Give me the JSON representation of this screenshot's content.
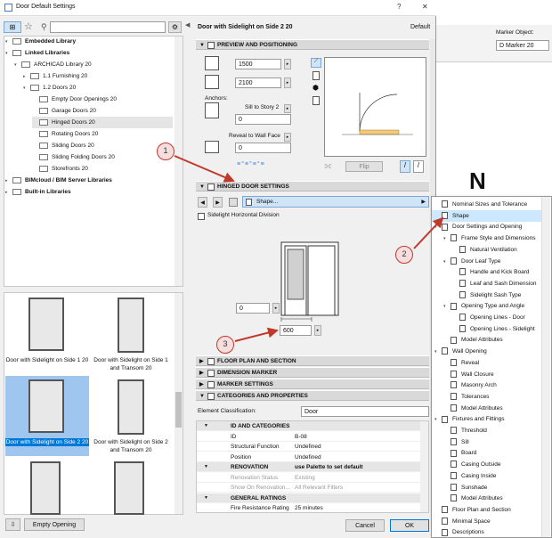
{
  "window": {
    "title": "Door Default Settings",
    "help": "?",
    "close": "✕"
  },
  "header": {
    "name": "Door with Sidelight on Side 2 20",
    "default_label": "Default"
  },
  "bg_app": {
    "marker_label": "Marker Object:",
    "marker_value": "D Marker 20",
    "north_letter": "N"
  },
  "library_tree": [
    {
      "label": "Embedded Library",
      "level": 0
    },
    {
      "label": "Linked Libraries",
      "level": 0
    },
    {
      "label": "ARCHICAD Library 20",
      "level": 1
    },
    {
      "label": "1.1 Furnishing 20",
      "level": 2
    },
    {
      "label": "1.2 Doors 20",
      "level": 2
    },
    {
      "label": "Empty Door Openings 20",
      "level": 3
    },
    {
      "label": "Garage Doors 20",
      "level": 3
    },
    {
      "label": "Hinged Doors 20",
      "level": 3,
      "selected": true
    },
    {
      "label": "Rotating Doors 20",
      "level": 3
    },
    {
      "label": "Sliding Doors 20",
      "level": 3
    },
    {
      "label": "Sliding Folding Doors 20",
      "level": 3
    },
    {
      "label": "Storefronts 20",
      "level": 3
    },
    {
      "label": "BIMcloud / BIM Server Libraries",
      "level": 0
    },
    {
      "label": "Built-in Libraries",
      "level": 0
    }
  ],
  "thumbnails": [
    {
      "label": "Door with Sidelight on Side 1 20"
    },
    {
      "label": "Door with Sidelight on Side 1 and Transom 20"
    },
    {
      "label": "Door with Sidelight on Side 2 20",
      "selected": true
    },
    {
      "label": "Door with Sidelight on Side 2 and Transom 20"
    }
  ],
  "footer": {
    "empty_opening": "Empty Opening",
    "cancel": "Cancel",
    "ok": "OK"
  },
  "preview": {
    "title": "PREVIEW AND POSITIONING",
    "width": "1500",
    "height": "2100",
    "anchors_label": "Anchors:",
    "sill_label": "Sill to Story 2",
    "sill_value": "0",
    "reveal_label": "Reveal to Wall Face",
    "reveal_value": "0",
    "flip_label": "Flip"
  },
  "hinged": {
    "title": "HINGED DOOR SETTINGS",
    "page_selector": "Shape...",
    "sidelight_checkbox": "Sidelight Horizontal Division",
    "bottom_value": "0",
    "sidelight_width": "600"
  },
  "sections": {
    "floor_plan": "FLOOR PLAN AND SECTION",
    "dimension": "DIMENSION MARKER",
    "marker": "MARKER SETTINGS",
    "categories": "CATEGORIES AND PROPERTIES"
  },
  "classification": {
    "label": "Element Classification:",
    "value": "Door"
  },
  "properties": [
    {
      "name": "ID AND CATEGORIES",
      "value": "",
      "type": "group"
    },
    {
      "name": "ID",
      "value": "B-08",
      "type": "row"
    },
    {
      "name": "Structural Function",
      "value": "Undefined",
      "type": "row"
    },
    {
      "name": "Position",
      "value": "Undefined",
      "type": "row"
    },
    {
      "name": "RENOVATION",
      "value": "use Palette to set default",
      "type": "group"
    },
    {
      "name": "Renovation Status",
      "value": "Existing",
      "type": "dim"
    },
    {
      "name": "Show On Renovation...",
      "value": "All Relevant Filters",
      "type": "dim"
    },
    {
      "name": "GENERAL RATINGS",
      "value": "",
      "type": "group"
    },
    {
      "name": "Fire Resistance Rating",
      "value": "25 minutes",
      "type": "row"
    }
  ],
  "menu": [
    {
      "label": "Nominal Sizes and Tolerance",
      "level": 0
    },
    {
      "label": "Shape",
      "level": 0,
      "selected": true
    },
    {
      "label": "Door Settings and Opening",
      "level": 0
    },
    {
      "label": "Frame Style and Dimensions",
      "level": 1
    },
    {
      "label": "Natural Ventilation",
      "level": 2
    },
    {
      "label": "Door Leaf Type",
      "level": 1
    },
    {
      "label": "Handle and Kick Board",
      "level": 2
    },
    {
      "label": "Leaf and Sash Dimension",
      "level": 2
    },
    {
      "label": "Sidelight Sash Type",
      "level": 2
    },
    {
      "label": "Opening Type and Angle",
      "level": 1
    },
    {
      "label": "Opening Lines - Door",
      "level": 2
    },
    {
      "label": "Opening Lines - Sidelight",
      "level": 2
    },
    {
      "label": "Model Attributes",
      "level": 1
    },
    {
      "label": "Wall Opening",
      "level": 0
    },
    {
      "label": "Reveal",
      "level": 1
    },
    {
      "label": "Wall Closure",
      "level": 1
    },
    {
      "label": "Masonry Arch",
      "level": 1
    },
    {
      "label": "Tolerances",
      "level": 1
    },
    {
      "label": "Model Attributes",
      "level": 1
    },
    {
      "label": "Fixtures and Fittings",
      "level": 0
    },
    {
      "label": "Threshold",
      "level": 1
    },
    {
      "label": "Sill",
      "level": 1
    },
    {
      "label": "Board",
      "level": 1
    },
    {
      "label": "Casing Outside",
      "level": 1
    },
    {
      "label": "Casing Inside",
      "level": 1
    },
    {
      "label": "Sunshade",
      "level": 1
    },
    {
      "label": "Model Attributes",
      "level": 1
    },
    {
      "label": "Floor Plan and Section",
      "level": 0
    },
    {
      "label": "Minimal Space",
      "level": 0
    },
    {
      "label": "Descriptions",
      "level": 0
    }
  ],
  "callouts": [
    {
      "label": "1"
    },
    {
      "label": "2"
    },
    {
      "label": "3"
    }
  ],
  "colors": {
    "accent": "#0078d7",
    "selected_row": "#cce8ff",
    "callout": "#c0392b",
    "section_bg": "#d9d9d9"
  }
}
